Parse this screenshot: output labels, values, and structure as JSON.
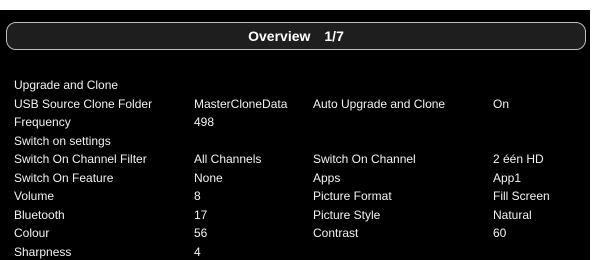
{
  "header": {
    "title": "Overview",
    "page": "1/7"
  },
  "rows": [
    [
      "Upgrade and Clone",
      "",
      "",
      ""
    ],
    [
      "USB Source Clone Folder",
      "MasterCloneData",
      "Auto Upgrade and Clone",
      "On"
    ],
    [
      "Frequency",
      "498",
      "",
      ""
    ],
    [
      "Switch on settings",
      "",
      "",
      ""
    ],
    [
      "Switch On Channel Filter",
      "All Channels",
      "Switch On Channel",
      "2 één HD"
    ],
    [
      "Switch On Feature",
      "None",
      "Apps",
      "App1"
    ],
    [
      "Volume",
      "8",
      "Picture Format",
      "Fill Screen"
    ],
    [
      "Bluetooth",
      "17",
      "Picture Style",
      "Natural"
    ],
    [
      "Colour",
      "56",
      "Contrast",
      "60"
    ],
    [
      "Sharpness",
      "4",
      "",
      ""
    ]
  ]
}
